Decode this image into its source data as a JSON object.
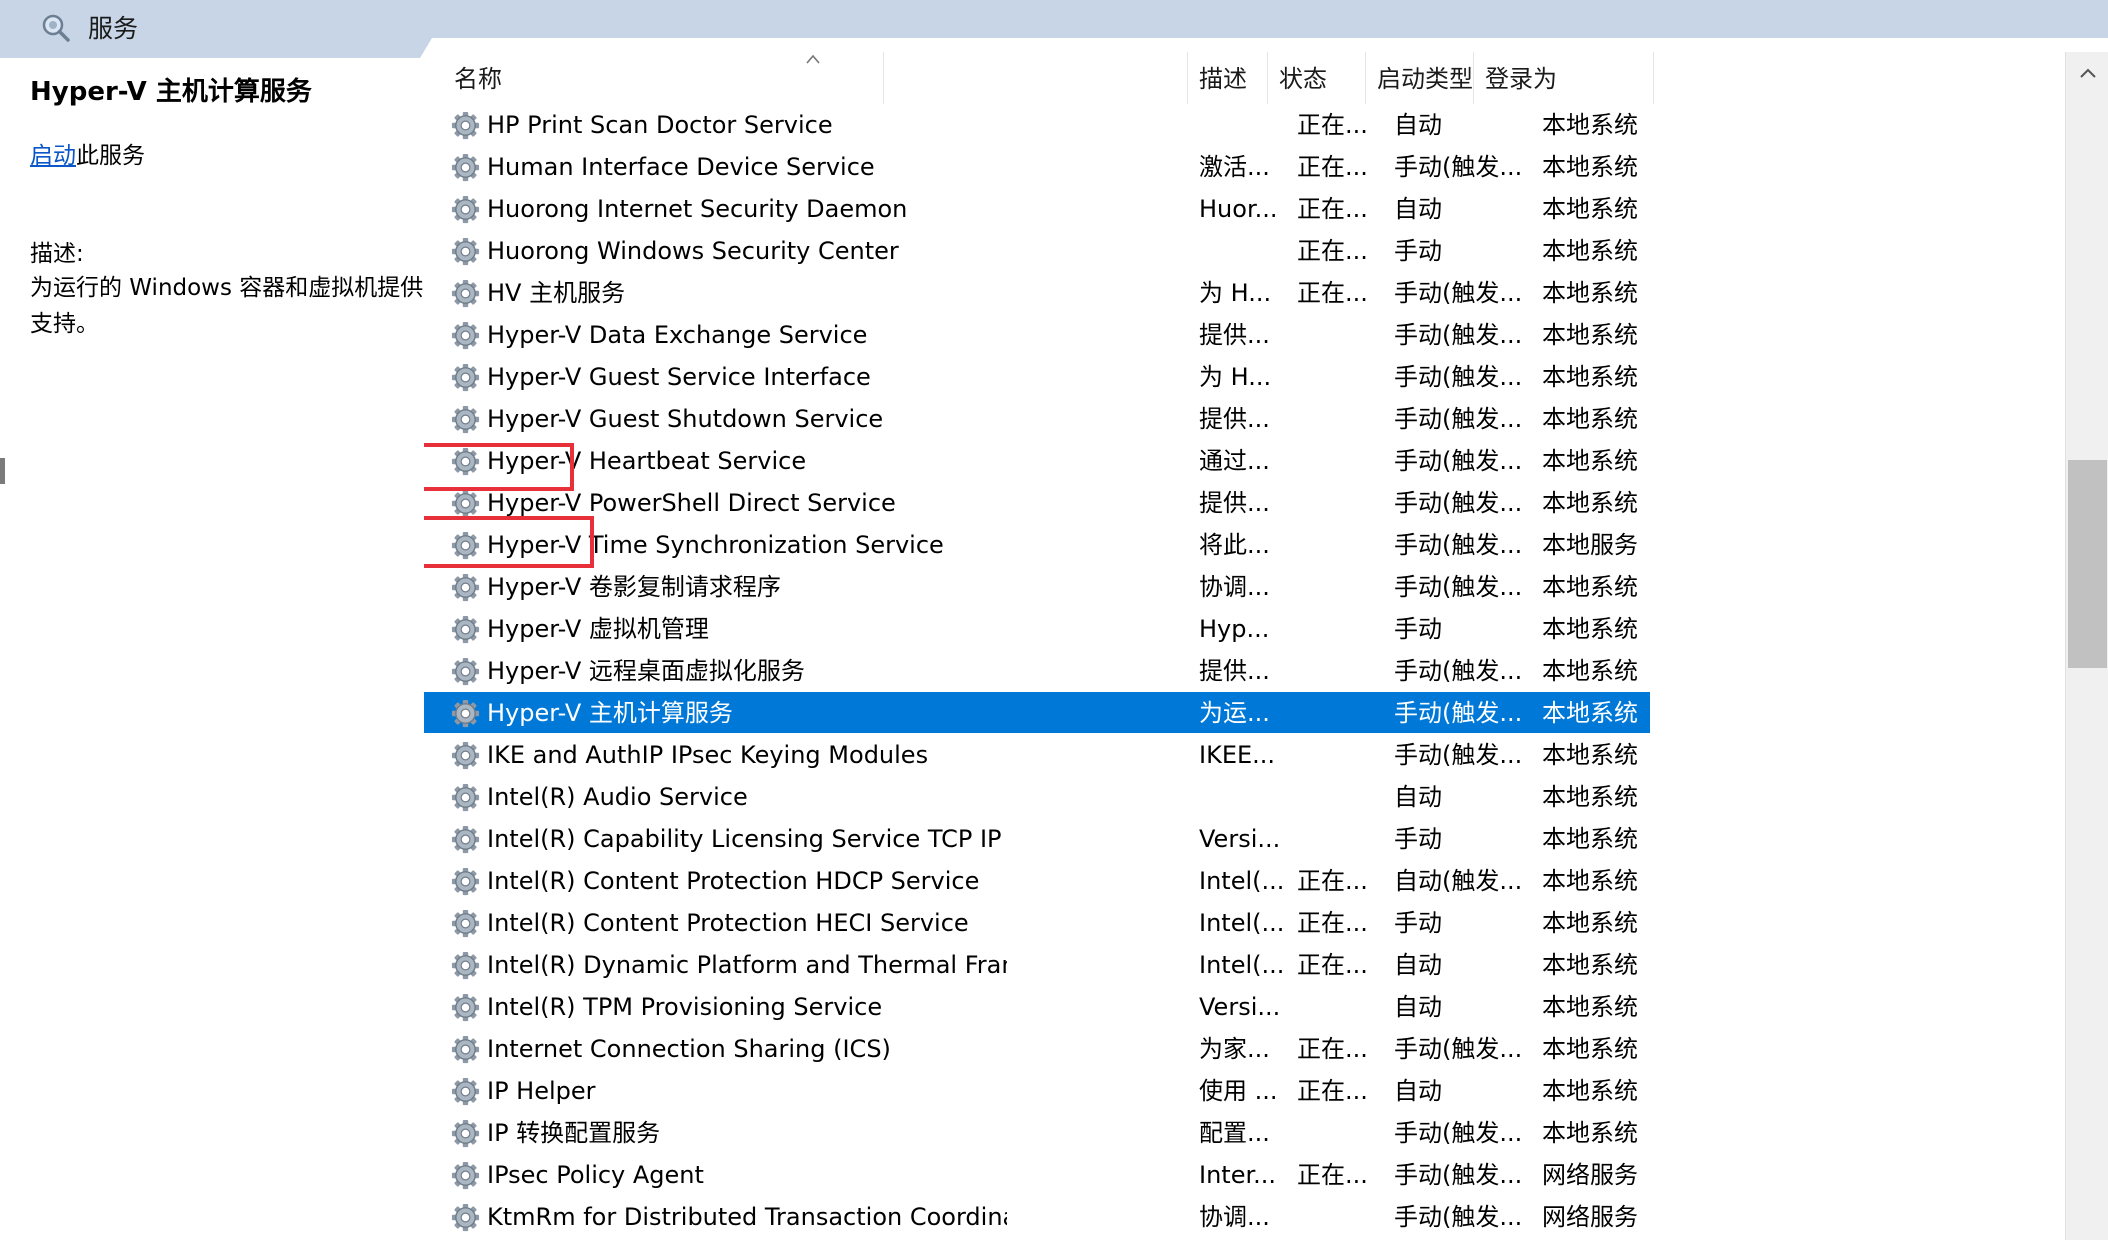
{
  "header": {
    "title": "服务",
    "icon": "services-search-icon"
  },
  "left_pane": {
    "service_title": "Hyper-V 主机计算服务",
    "start_link": "启动",
    "start_suffix": "此服务",
    "description_label": "描述:",
    "description_text": "为运行的 Windows 容器和虚拟机提供支持。"
  },
  "columns": {
    "name": "名称",
    "description": "描述",
    "status": "状态",
    "startup_type": "启动类型",
    "logon_as": "登录为"
  },
  "rows": [
    {
      "name": "HP Print Scan Doctor Service",
      "desc": "",
      "status": "正在...",
      "start": "自动",
      "logon": "本地系统"
    },
    {
      "name": "Human Interface Device Service",
      "desc": "激活...",
      "status": "正在...",
      "start": "手动(触发...",
      "logon": "本地系统"
    },
    {
      "name": "Huorong Internet Security Daemon",
      "desc": "Huor...",
      "status": "正在...",
      "start": "自动",
      "logon": "本地系统"
    },
    {
      "name": "Huorong Windows Security Center",
      "desc": "",
      "status": "正在...",
      "start": "手动",
      "logon": "本地系统"
    },
    {
      "name": "HV 主机服务",
      "desc": "为 H...",
      "status": "正在...",
      "start": "手动(触发...",
      "logon": "本地系统"
    },
    {
      "name": "Hyper-V Data Exchange Service",
      "desc": "提供...",
      "status": "",
      "start": "手动(触发...",
      "logon": "本地系统"
    },
    {
      "name": "Hyper-V Guest Service Interface",
      "desc": "为 H...",
      "status": "",
      "start": "手动(触发...",
      "logon": "本地系统"
    },
    {
      "name": "Hyper-V Guest Shutdown Service",
      "desc": "提供...",
      "status": "",
      "start": "手动(触发...",
      "logon": "本地系统"
    },
    {
      "name": "Hyper-V Heartbeat Service",
      "desc": "通过...",
      "status": "",
      "start": "手动(触发...",
      "logon": "本地系统"
    },
    {
      "name": "Hyper-V PowerShell Direct Service",
      "desc": "提供...",
      "status": "",
      "start": "手动(触发...",
      "logon": "本地系统"
    },
    {
      "name": "Hyper-V Time Synchronization Service",
      "desc": "将此...",
      "status": "",
      "start": "手动(触发...",
      "logon": "本地服务"
    },
    {
      "name": "Hyper-V 卷影复制请求程序",
      "desc": "协调...",
      "status": "",
      "start": "手动(触发...",
      "logon": "本地系统"
    },
    {
      "name": "Hyper-V 虚拟机管理",
      "desc": "Hyp...",
      "status": "",
      "start": "手动",
      "logon": "本地系统"
    },
    {
      "name": "Hyper-V 远程桌面虚拟化服务",
      "desc": "提供...",
      "status": "",
      "start": "手动(触发...",
      "logon": "本地系统"
    },
    {
      "name": "Hyper-V 主机计算服务",
      "desc": "为运...",
      "status": "",
      "start": "手动(触发...",
      "logon": "本地系统",
      "selected": true
    },
    {
      "name": "IKE and AuthIP IPsec Keying Modules",
      "desc": "IKEE...",
      "status": "",
      "start": "手动(触发...",
      "logon": "本地系统"
    },
    {
      "name": "Intel(R) Audio Service",
      "desc": "",
      "status": "",
      "start": "自动",
      "logon": "本地系统"
    },
    {
      "name": "Intel(R) Capability Licensing Service TCP IP Interface",
      "desc": "Versi...",
      "status": "",
      "start": "手动",
      "logon": "本地系统"
    },
    {
      "name": "Intel(R) Content Protection HDCP Service",
      "desc": "Intel(...",
      "status": "正在...",
      "start": "自动(触发...",
      "logon": "本地系统"
    },
    {
      "name": "Intel(R) Content Protection HECI Service",
      "desc": "Intel(...",
      "status": "正在...",
      "start": "手动",
      "logon": "本地系统"
    },
    {
      "name": "Intel(R) Dynamic Platform and Thermal Framework service",
      "desc": "Intel(...",
      "status": "正在...",
      "start": "自动",
      "logon": "本地系统"
    },
    {
      "name": "Intel(R) TPM Provisioning Service",
      "desc": "Versi...",
      "status": "",
      "start": "自动",
      "logon": "本地系统"
    },
    {
      "name": "Internet Connection Sharing (ICS)",
      "desc": "为家...",
      "status": "正在...",
      "start": "手动(触发...",
      "logon": "本地系统"
    },
    {
      "name": "IP Helper",
      "desc": "使用 ...",
      "status": "正在...",
      "start": "自动",
      "logon": "本地系统"
    },
    {
      "name": "IP 转换配置服务",
      "desc": "配置...",
      "status": "",
      "start": "手动(触发...",
      "logon": "本地系统"
    },
    {
      "name": "IPsec Policy Agent",
      "desc": "Inter...",
      "status": "正在...",
      "start": "手动(触发...",
      "logon": "网络服务"
    },
    {
      "name": "KtmRm for Distributed Transaction Coordinator",
      "desc": "协调...",
      "status": "",
      "start": "手动(触发...",
      "logon": "网络服务"
    }
  ],
  "row_icon": "service-gear-icon",
  "colors": {
    "selection": "#0078d7",
    "annotation": "#e8303a",
    "header_bar": "#c7d5e6"
  }
}
